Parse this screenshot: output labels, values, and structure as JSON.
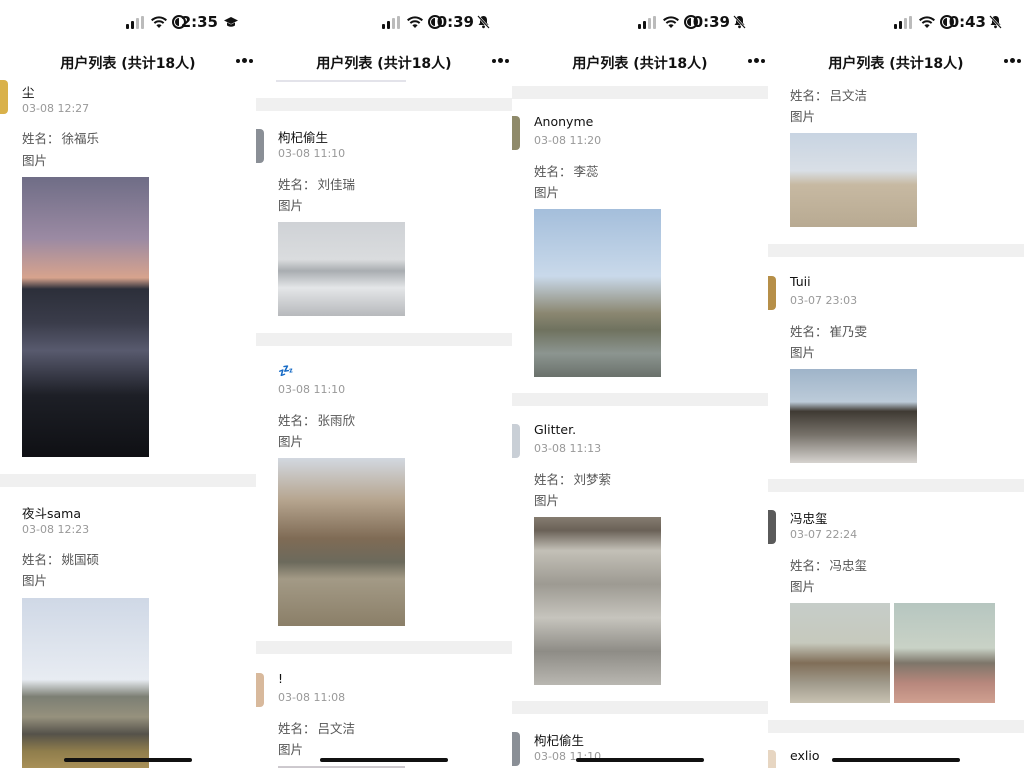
{
  "panels": [
    {
      "time": "2:35",
      "header_title": "用户列表 (共计18人)",
      "entries": [
        {
          "username": "尘",
          "time": "03-08 12:27",
          "field_label": "姓名：",
          "field_value": "徐福乐",
          "image_label": "图片",
          "photos": [
            {
              "scene": "dusk"
            }
          ]
        },
        {
          "username": "夜斗sama",
          "time": "03-08 12:23",
          "field_label": "姓名：",
          "field_value": "姚国硕",
          "image_label": "图片",
          "photos": [
            {
              "scene": "campus"
            }
          ]
        }
      ]
    },
    {
      "time": "0:39",
      "header_title": "用户列表 (共计18人)",
      "entries": [
        {
          "username": "枸杞偷生",
          "time": "03-08 11:10",
          "field_label": "姓名：",
          "field_value": "刘佳瑞",
          "image_label": "图片",
          "photos": [
            {
              "scene": "snow"
            }
          ]
        },
        {
          "username": "💤",
          "time": "03-08 11:10",
          "field_label": "姓名：",
          "field_value": "张雨欣",
          "image_label": "图片",
          "photos": [
            {
              "scene": "willow"
            }
          ]
        },
        {
          "username": "!",
          "time": "03-08 11:08",
          "field_label": "姓名：",
          "field_value": "吕文洁",
          "image_label": "图片",
          "photos": [
            {
              "scene": "blocked"
            }
          ]
        }
      ]
    },
    {
      "time": "0:39",
      "header_title": "用户列表 (共计18人)",
      "entries": [
        {
          "username": "Anonyme",
          "time": "03-08 11:20",
          "field_label": "姓名：",
          "field_value": "李蕊",
          "image_label": "图片",
          "photos": [
            {
              "scene": "pond"
            }
          ]
        },
        {
          "username": "Glitter.",
          "time": "03-08 11:13",
          "field_label": "姓名：",
          "field_value": "刘梦萦",
          "image_label": "图片",
          "photos": [
            {
              "scene": "ducks"
            }
          ]
        },
        {
          "username": "枸杞偷生",
          "time": "03-08 11:10",
          "field_label": "",
          "field_value": "",
          "image_label": "",
          "photos": []
        }
      ]
    },
    {
      "time": "0:43",
      "header_title": "用户列表 (共计18人)",
      "entries": [
        {
          "username": "",
          "time": "",
          "field_label": "姓名：",
          "field_value": "吕文洁",
          "image_label": "图片",
          "photos": [
            {
              "scene": "gate"
            }
          ]
        },
        {
          "username": "Tuii",
          "time": "03-07 23:03",
          "field_label": "姓名：",
          "field_value": "崔乃雯",
          "image_label": "图片",
          "photos": [
            {
              "scene": "eaves"
            }
          ]
        },
        {
          "username": "冯忠玺",
          "time": "03-07 22:24",
          "field_label": "姓名：",
          "field_value": "冯忠玺",
          "image_label": "图片",
          "photos": [
            {
              "scene": "tree"
            },
            {
              "scene": "road"
            }
          ]
        },
        {
          "username": "exlio",
          "time": "",
          "field_label": "",
          "field_value": "",
          "image_label": "",
          "photos": []
        }
      ]
    }
  ]
}
